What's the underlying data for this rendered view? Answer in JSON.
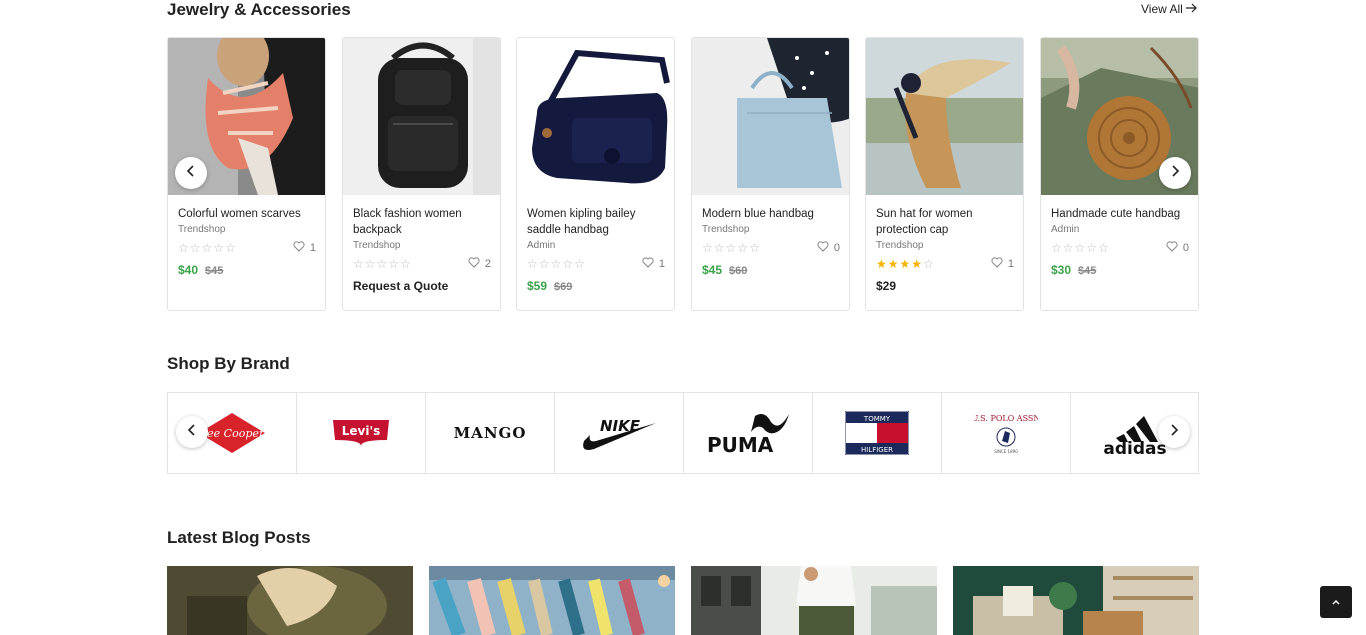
{
  "jewelry": {
    "title": "Jewelry & Accessories",
    "view_all": "View All",
    "products": [
      {
        "name": "Colorful women scarves",
        "shop": "Trendshop",
        "rating": 0,
        "likes": "1",
        "price": "$40",
        "old_price": "$45"
      },
      {
        "name": "Black fashion women backpack",
        "shop": "Trendshop",
        "rating": 0,
        "likes": "2",
        "quote": "Request a Quote"
      },
      {
        "name": "Women kipling bailey saddle handbag",
        "shop": "Admin",
        "rating": 0,
        "likes": "1",
        "price": "$59",
        "old_price": "$69"
      },
      {
        "name": "Modern blue handbag",
        "shop": "Trendshop",
        "rating": 0,
        "likes": "0",
        "price": "$45",
        "old_price": "$60"
      },
      {
        "name": "Sun hat for women protection cap",
        "shop": "Trendshop",
        "rating": 4,
        "likes": "1",
        "price_plain": "$29"
      },
      {
        "name": "Handmade cute handbag",
        "shop": "Admin",
        "rating": 0,
        "likes": "0",
        "price": "$30",
        "old_price": "$45"
      }
    ]
  },
  "brands": {
    "title": "Shop By Brand",
    "logos": [
      "Lee Cooper",
      "Levi's",
      "MANGO",
      "NIKE",
      "PUMA",
      "TOMMY HILFIGER",
      "U.S. POLO ASSN.",
      "adidas"
    ],
    "logo_texts": {
      "lee_cooper": "Lee Cooper",
      "levis": "Levi's",
      "mango": "MANGO",
      "puma": "PUMA",
      "tommy_top": "TOMMY",
      "tommy_bottom": "HILFIGER",
      "polo_top": "U.S. POLO ASSN",
      "polo_bottom": "SINCE 1890",
      "adidas": "adidas"
    }
  },
  "blog": {
    "title": "Latest Blog Posts"
  },
  "colors": {
    "price_green": "#3aa34a",
    "star_gold": "#f5b301",
    "scroll_top_bg": "#1b1b1b"
  },
  "icons": {
    "prev": "chevron-left-icon",
    "next": "chevron-right-icon",
    "like": "heart-icon",
    "view_all": "arrow-right-icon",
    "scroll_top": "chevron-up-icon"
  }
}
